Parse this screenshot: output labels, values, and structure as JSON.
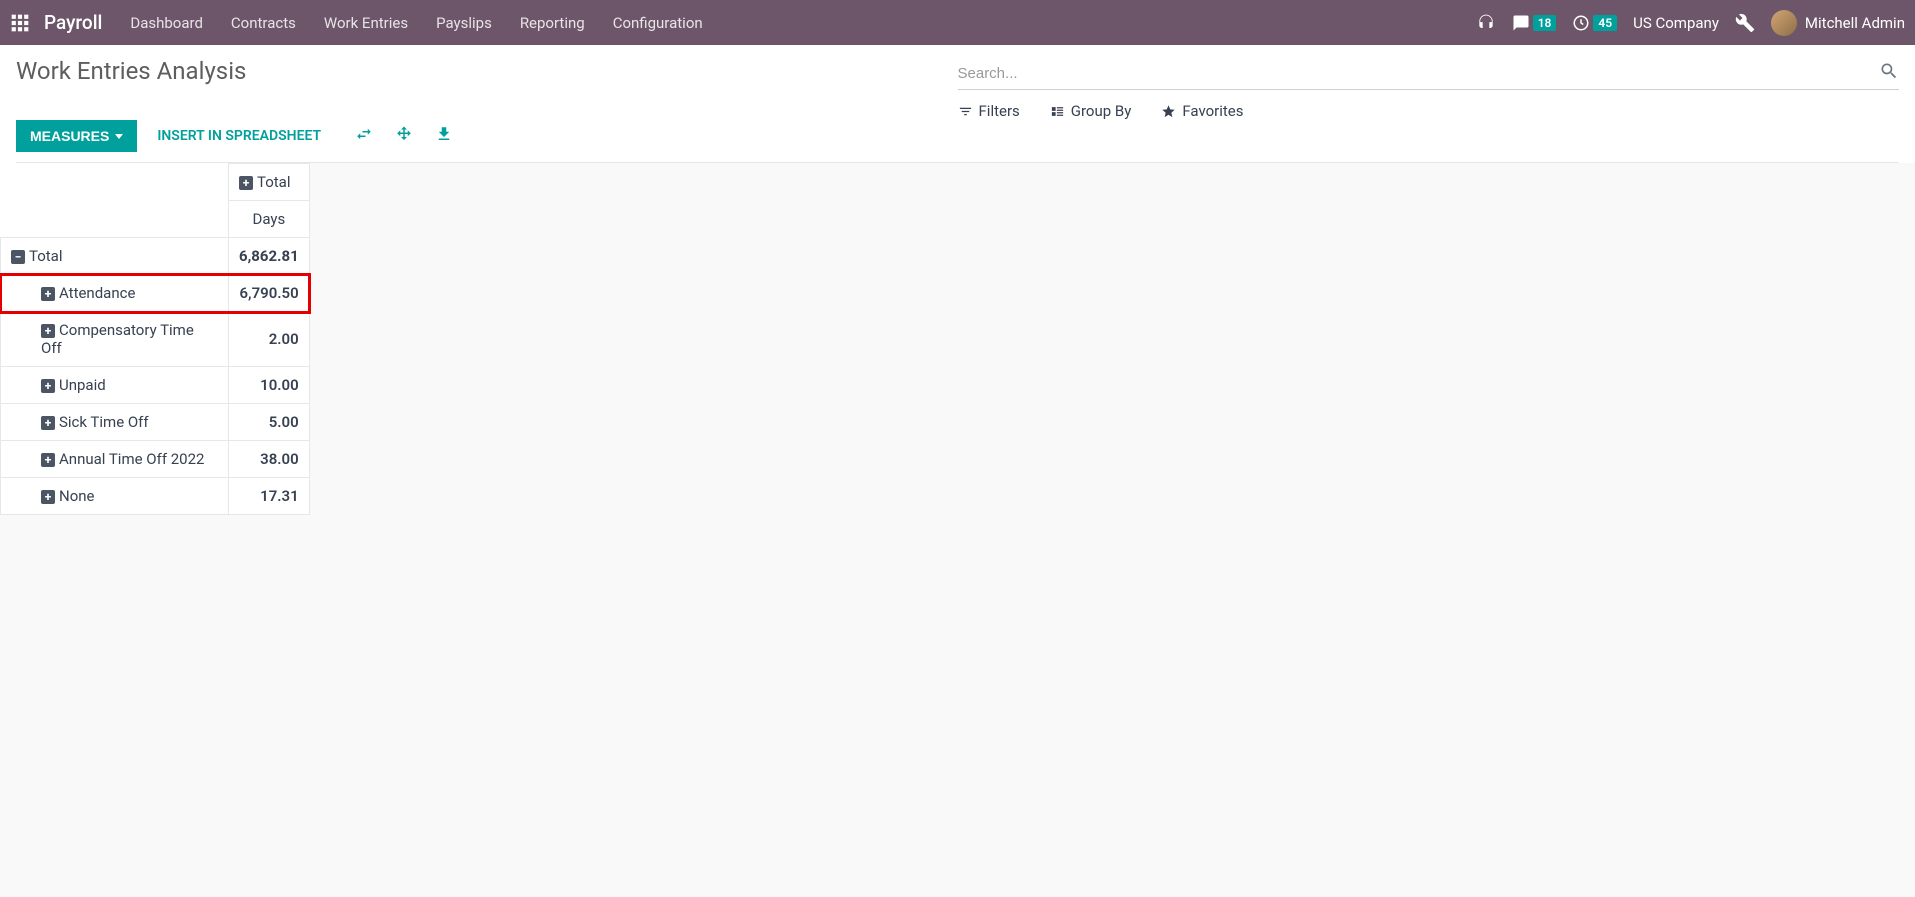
{
  "topnav": {
    "brand": "Payroll",
    "items": [
      "Dashboard",
      "Contracts",
      "Work Entries",
      "Payslips",
      "Reporting",
      "Configuration"
    ],
    "messages_badge": "18",
    "activities_badge": "45",
    "company": "US Company",
    "user": "Mitchell Admin"
  },
  "page": {
    "title": "Work Entries Analysis",
    "measures_label": "MEASURES",
    "spreadsheet_label": "INSERT IN SPREADSHEET",
    "search_placeholder": "Search...",
    "filters_label": "Filters",
    "groupby_label": "Group By",
    "favorites_label": "Favorites"
  },
  "pivot": {
    "col_total_label": "Total",
    "measure_label": "Days",
    "total_row": {
      "label": "Total",
      "value": "6,862.81"
    },
    "rows": [
      {
        "label": "Attendance",
        "value": "6,790.50",
        "highlighted": true
      },
      {
        "label": "Compensatory Time Off",
        "value": "2.00"
      },
      {
        "label": "Unpaid",
        "value": "10.00"
      },
      {
        "label": "Sick Time Off",
        "value": "5.00"
      },
      {
        "label": "Annual Time Off 2022",
        "value": "38.00"
      },
      {
        "label": "None",
        "value": "17.31"
      }
    ]
  }
}
